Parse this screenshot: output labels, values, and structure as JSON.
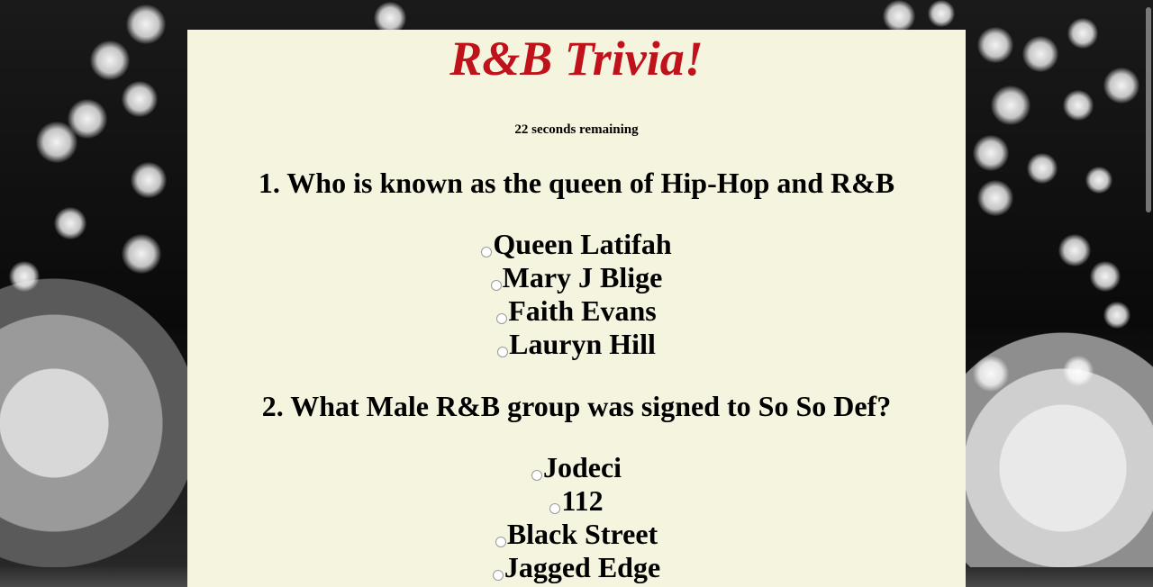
{
  "title": "R&B Trivia!",
  "timer": "22 seconds remaining",
  "questions": [
    {
      "text": "1. Who is known as the queen of Hip-Hop and R&B",
      "options": [
        "Queen Latifah",
        "Mary J Blige",
        "Faith Evans",
        "Lauryn Hill"
      ]
    },
    {
      "text": "2. What Male R&B group was signed to So So Def?",
      "options": [
        "Jodeci",
        "112",
        "Black Street",
        "Jagged Edge"
      ]
    }
  ],
  "colors": {
    "title": "#c0121b",
    "panel_background": "#f5f4df",
    "page_background": "#0b0b0b"
  }
}
